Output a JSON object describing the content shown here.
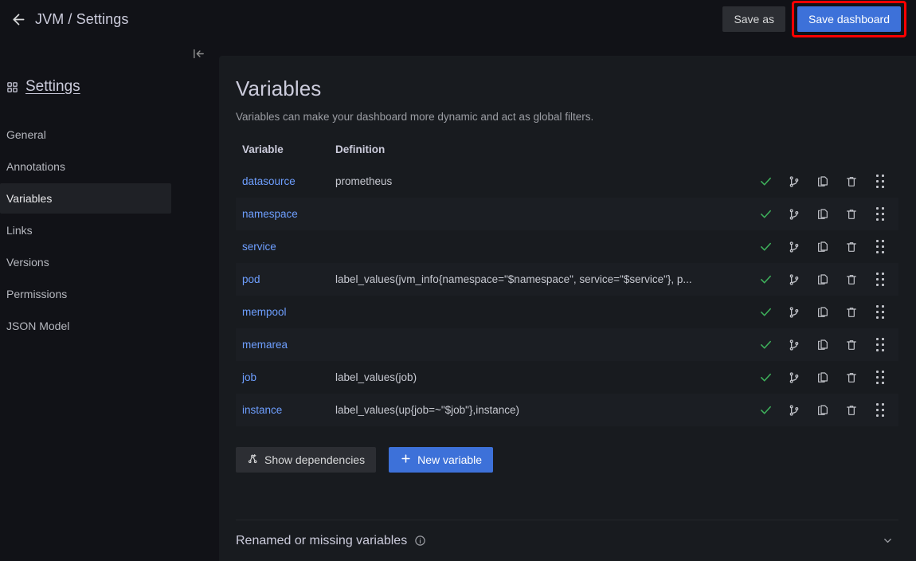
{
  "header": {
    "back_icon": "arrow-left-icon",
    "breadcrumb": "JVM / Settings",
    "save_as_label": "Save as",
    "save_dashboard_label": "Save dashboard",
    "highlight_color": "#ff0000",
    "primary_color": "#3d71d9"
  },
  "sidebar": {
    "collapse_icon": "collapse-panel-icon",
    "settings_icon": "apps-grid-icon",
    "settings_label": "Settings",
    "items": [
      {
        "label": "General",
        "active": false
      },
      {
        "label": "Annotations",
        "active": false
      },
      {
        "label": "Variables",
        "active": true
      },
      {
        "label": "Links",
        "active": false
      },
      {
        "label": "Versions",
        "active": false
      },
      {
        "label": "Permissions",
        "active": false
      },
      {
        "label": "JSON Model",
        "active": false
      }
    ]
  },
  "main": {
    "title": "Variables",
    "description": "Variables can make your dashboard more dynamic and act as global filters.",
    "table": {
      "columns": [
        "Variable",
        "Definition"
      ],
      "rows": [
        {
          "variable": "datasource",
          "definition": "prometheus"
        },
        {
          "variable": "namespace",
          "definition": ""
        },
        {
          "variable": "service",
          "definition": ""
        },
        {
          "variable": "pod",
          "definition": "label_values(jvm_info{namespace=\"$namespace\", service=\"$service\"}, p..."
        },
        {
          "variable": "mempool",
          "definition": ""
        },
        {
          "variable": "memarea",
          "definition": ""
        },
        {
          "variable": "job",
          "definition": "label_values(job)"
        },
        {
          "variable": "instance",
          "definition": "label_values(up{job=~\"$job\"},instance)"
        }
      ],
      "row_action_icons": [
        "check-icon",
        "code-branch-icon",
        "copy-icon",
        "trash-icon",
        "drag-handle-icon"
      ],
      "check_color": "#3eb15b"
    },
    "show_dependencies_label": "Show dependencies",
    "show_dependencies_icon": "sitemap-icon",
    "new_variable_label": "New variable",
    "new_variable_icon": "plus-icon",
    "renamed_section": {
      "title": "Renamed or missing variables",
      "info_icon": "info-circle-icon",
      "expand_icon": "chevron-down-icon"
    }
  }
}
